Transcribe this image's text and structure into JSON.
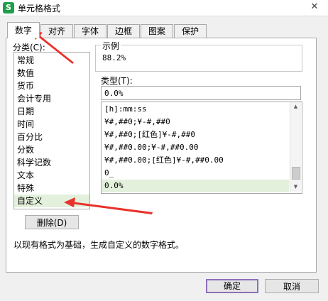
{
  "window": {
    "title": "单元格格式",
    "app_icon": "S",
    "close_glyph": "✕"
  },
  "tabs": [
    {
      "label": "数字",
      "active": true
    },
    {
      "label": "对齐"
    },
    {
      "label": "字体"
    },
    {
      "label": "边框"
    },
    {
      "label": "图案"
    },
    {
      "label": "保护"
    }
  ],
  "category": {
    "label": "分类(C):",
    "items": [
      "常规",
      "数值",
      "货币",
      "会计专用",
      "日期",
      "时间",
      "百分比",
      "分数",
      "科学记数",
      "文本",
      "特殊",
      "自定义"
    ],
    "selected": "自定义"
  },
  "sample": {
    "label": "示例",
    "value": "88.2%"
  },
  "type": {
    "label": "类型(T):",
    "value": "0.0%",
    "formats": [
      "[h]:mm:ss",
      "¥#,##0;¥-#,##0",
      "¥#,##0;[红色]¥-#,##0",
      "¥#,##0.00;¥-#,##0.00",
      "¥#,##0.00;[红色]¥-#,##0.00",
      "0_",
      "0.0%"
    ],
    "selected": "0.0%"
  },
  "delete_label": "删除(D)",
  "description": "以现有格式为基础，生成自定义的数字格式。",
  "ok_label": "确定",
  "cancel_label": "取消",
  "colors": {
    "accent": "#8f6fb8",
    "selection": "#e2f0dc",
    "annotation": "#e8322b",
    "app": "#1e9e4a"
  }
}
